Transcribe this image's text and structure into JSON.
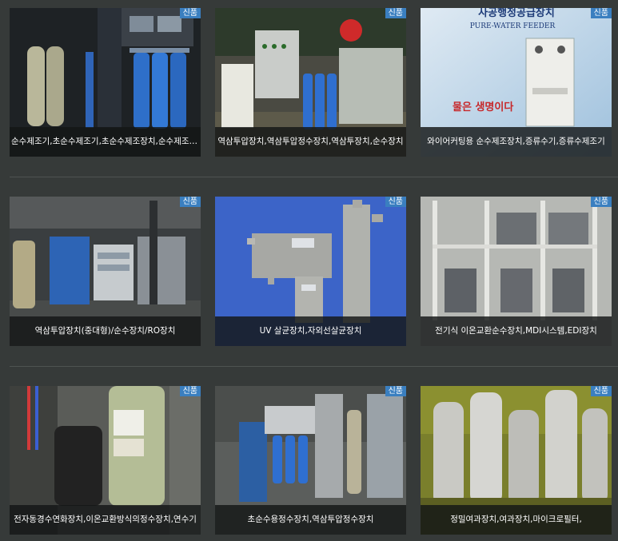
{
  "badge_label": "신품",
  "products": [
    {
      "title": "순수제조기,초순수제조기,초순수제조장치,순수제조장치",
      "badge": "신품",
      "image": "ro-plant-blue-filter-housings"
    },
    {
      "title": "역삼투압장치,역삼투압정수장치,역삼투장치,순수장치",
      "badge": "신품",
      "image": "ro-skid-with-control-panel"
    },
    {
      "title": "와이어커팅용 순수제조장치,증류수기,증류수제조기",
      "badge": "신품",
      "image": "pure-water-feeder-cabinet"
    },
    {
      "title": "역삼투압장치(중대형)/순수장치/RO장치",
      "badge": "신품",
      "image": "large-ro-system"
    },
    {
      "title": "UV 살균장치,자외선살균장치",
      "badge": "신품",
      "image": "uv-sterilizer"
    },
    {
      "title": "전기식 이온교환순수장치,MDI시스템,EDI장치",
      "badge": "신품",
      "image": "edi-system-frame"
    },
    {
      "title": "전자동경수연화장치,이온교환방식의정수장치,연수기",
      "badge": "신품",
      "image": "water-softener-tank"
    },
    {
      "title": "초순수용정수장치,역삼투압정수장치",
      "badge": "신품",
      "image": "ultrapure-water-unit"
    },
    {
      "title": "정밀여과장치,여과장치,마이크로필터,",
      "badge": "신품",
      "image": "stainless-bag-filters"
    }
  ],
  "image_texts": {
    "feeder_sign": "사공행정공급장치",
    "feeder_sign_en": "PURE-WATER FEEDER",
    "feeder_slogan": "물은 생명이다"
  }
}
